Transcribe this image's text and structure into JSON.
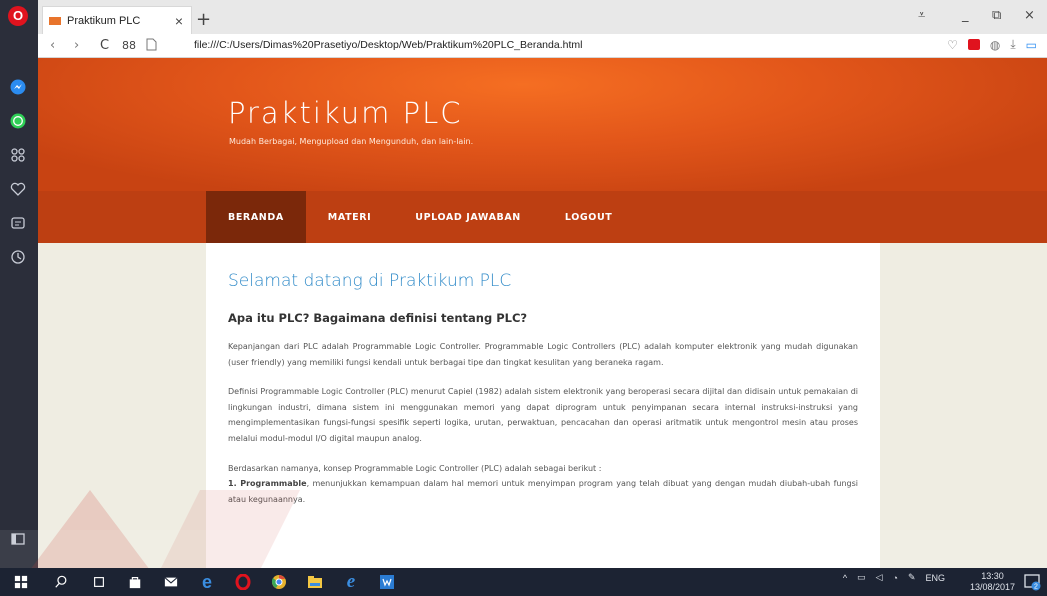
{
  "browser": {
    "tab_title": "Praktikum PLC",
    "tab_close": "×",
    "new_tab": "+",
    "url": "file:///C:/Users/Dimas%20Prasetiyo/Desktop/Web/Praktikum%20PLC_Beranda.html",
    "nav_back": "‹",
    "nav_forward": "›",
    "nav_reload": "C",
    "nav_grid": "88",
    "window_controls": {
      "menu": "⩡",
      "minimize": "_",
      "restore": "⧉",
      "close": "×"
    }
  },
  "site": {
    "title": "Praktikum PLC",
    "tagline": "Mudah Berbagai, Mengupload dan Mengunduh, dan lain-lain.",
    "menu": [
      {
        "label": "BERANDA",
        "active": true
      },
      {
        "label": "MATERI",
        "active": false
      },
      {
        "label": "UPLOAD JAWABAN",
        "active": false
      },
      {
        "label": "LOGOUT",
        "active": false
      }
    ]
  },
  "content": {
    "heading": "Selamat datang di Praktikum PLC",
    "subheading": "Apa itu PLC? Bagaimana definisi tentang PLC?",
    "paragraph1": "Kepanjangan dari PLC adalah Programmable Logic Controller. Programmable Logic Controllers (PLC) adalah komputer elektronik yang mudah digunakan (user friendly) yang memiliki fungsi kendali untuk berbagai tipe dan tingkat kesulitan yang beraneka ragam.",
    "paragraph2": "Definisi Programmable Logic Controller (PLC) menurut Capiel (1982) adalah sistem elektronik yang beroperasi secara dijital dan didisain untuk pemakaian di lingkungan industri, dimana sistem ini menggunakan memori yang dapat diprogram untuk penyimpanan secara internal instruksi-instruksi yang mengimplementasikan fungsi-fungsi spesifik seperti logika, urutan, perwaktuan, pencacahan dan operasi aritmatik untuk mengontrol mesin atau proses melalui modul-modul I/O digital maupun analog.",
    "paragraph3": "Berdasarkan namanya, konsep Programmable Logic Controller (PLC) adalah sebagai berikut :",
    "list_item1_label": "1. Programmable",
    "list_item1_text": ", menunjukkan kemampuan dalam hal memori untuk menyimpan program yang telah dibuat yang dengan mudah diubah-ubah fungsi atau kegunaannya."
  },
  "taskbar": {
    "language": "ENG",
    "time": "13:30",
    "date": "13/08/2017",
    "notification_count": "2"
  },
  "colors": {
    "header": "#e2561a",
    "nav": "#bd3f12",
    "nav_active": "#7b280a",
    "heading": "#2f8ac8",
    "taskbar": "#1c2333"
  }
}
